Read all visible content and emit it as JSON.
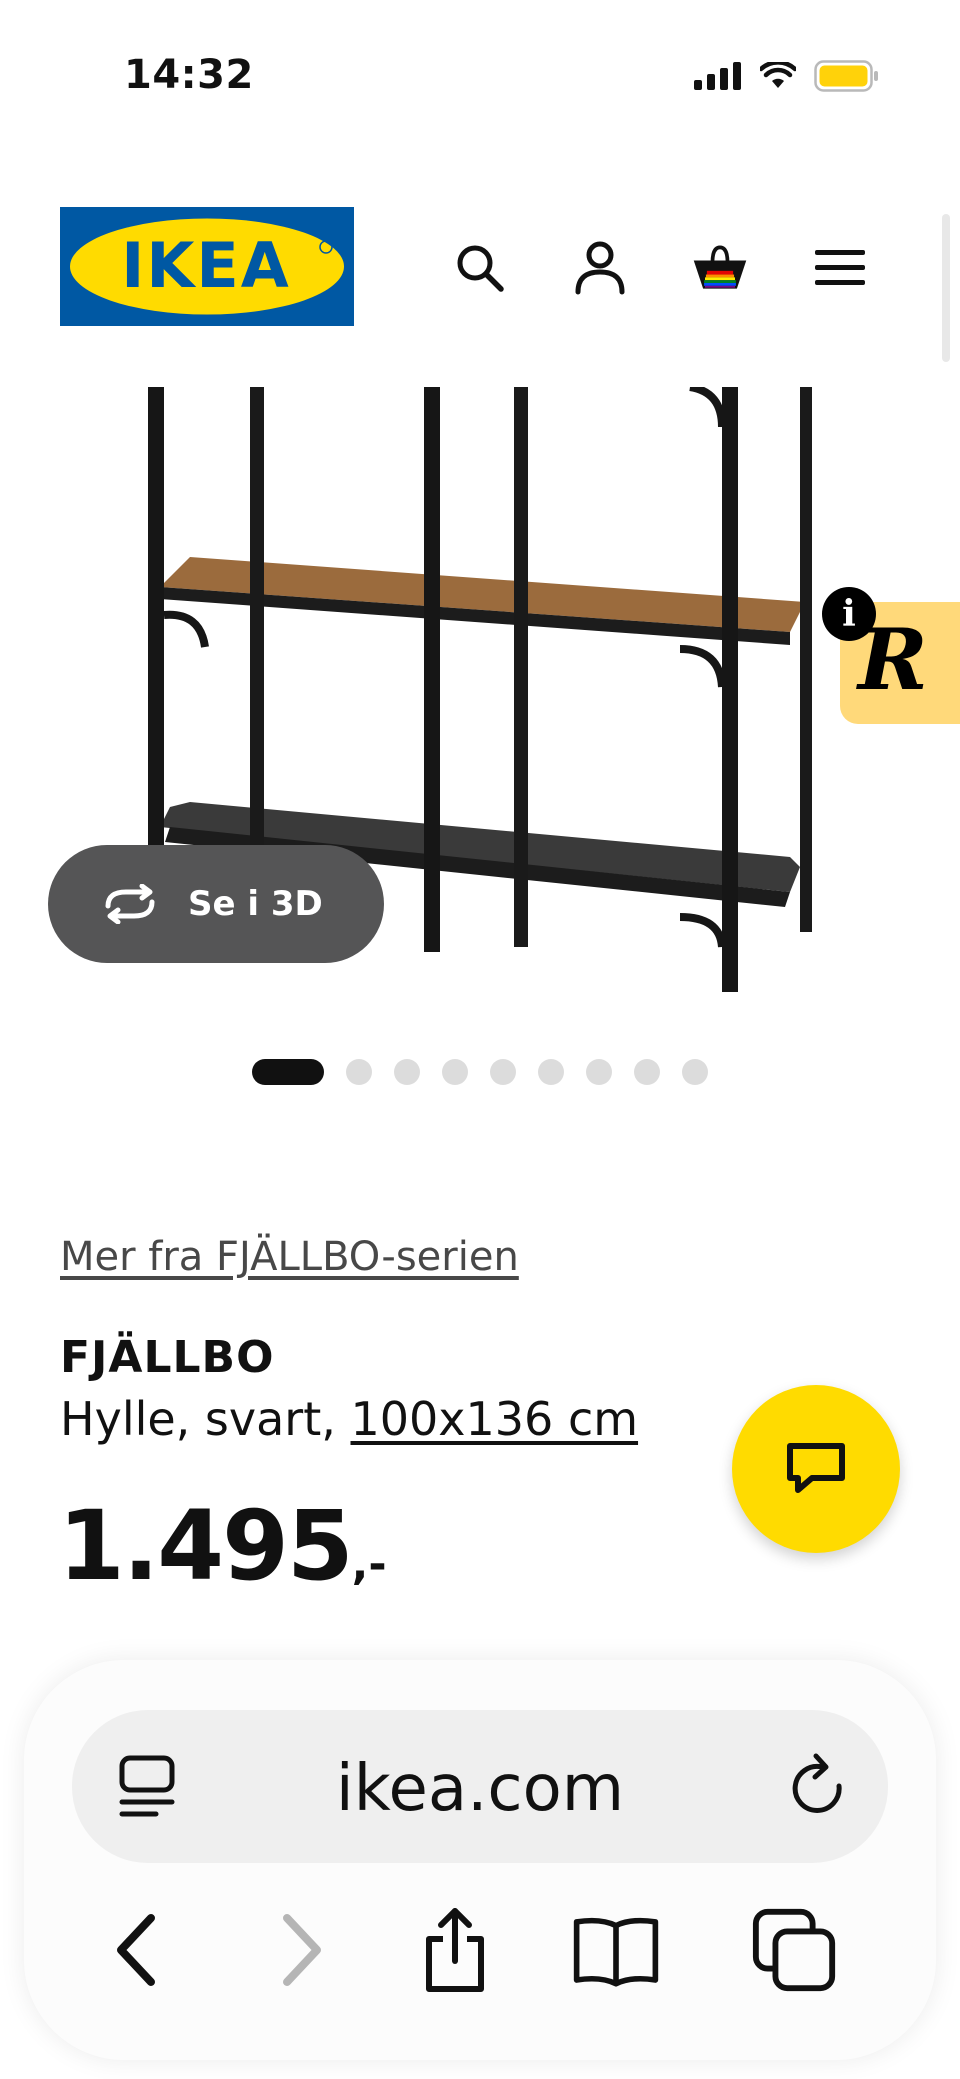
{
  "status_bar": {
    "time": "14:32",
    "icons": [
      "cellular-signal-icon",
      "wifi-icon",
      "battery-icon"
    ],
    "battery_color": "#ffd20a"
  },
  "header": {
    "logo_text": "IKEA",
    "icons": [
      "search-icon",
      "account-icon",
      "basket-icon",
      "menu-icon"
    ],
    "brand_blue": "#0058a3",
    "brand_yellow": "#ffdb00"
  },
  "product_gallery": {
    "view_3d_label": "Se i 3D",
    "dots_count": 9,
    "active_dot": 0
  },
  "product": {
    "series_link": "Mer fra FJÄLLBO-serien",
    "name": "FJÄLLBO",
    "description_prefix": "Hylle, svart, ",
    "dimensions_link": "100x136 cm",
    "price_main": "1.495",
    "price_suffix": ",-"
  },
  "floating": {
    "info_badge": "i",
    "extension_letter": "R",
    "chat_icon": "chat-bubble-icon"
  },
  "browser": {
    "url": "ikea.com",
    "toolbar_icons": [
      "back-icon",
      "forward-icon",
      "share-icon",
      "bookmarks-icon",
      "tabs-icon"
    ]
  }
}
